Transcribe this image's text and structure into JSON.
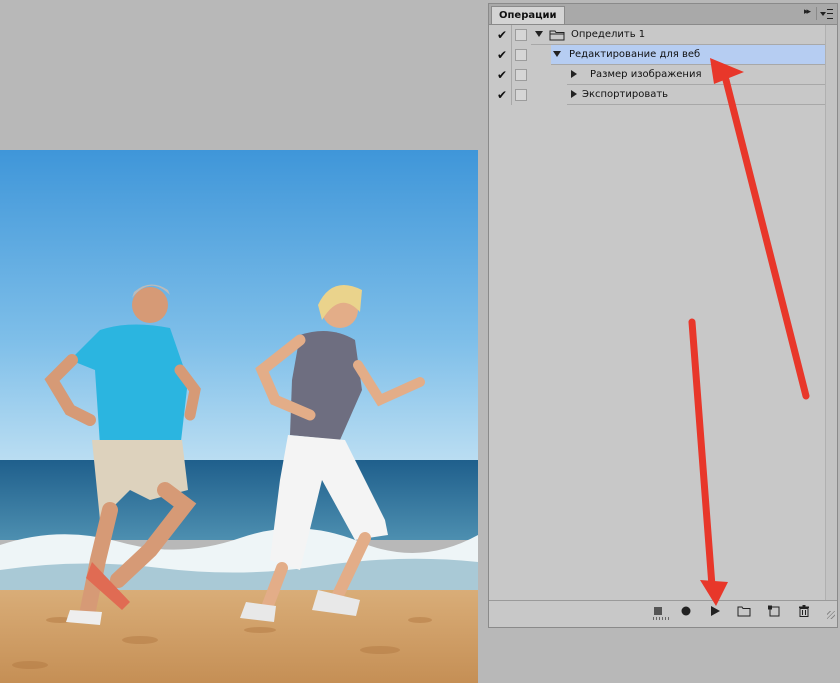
{
  "panel": {
    "tab_label": "Операции",
    "collapse_glyph": "▸▸",
    "actions": [
      {
        "label": "Определить 1",
        "checked": true,
        "expanded": true,
        "kind": "set",
        "selected": false
      },
      {
        "label": "Редактирование для веб",
        "checked": true,
        "expanded": true,
        "kind": "action",
        "selected": true
      },
      {
        "label": "Размер изображения",
        "checked": true,
        "expanded": false,
        "kind": "step",
        "selected": false
      },
      {
        "label": "Экспортировать",
        "checked": true,
        "expanded": false,
        "kind": "step",
        "selected": false
      }
    ],
    "footer_tools": [
      "stop-icon",
      "record-icon",
      "play-icon",
      "new-set-folder-icon",
      "new-action-icon",
      "trash-icon"
    ]
  },
  "icons": {
    "check": "✔"
  },
  "colors": {
    "selection": "#b6cdf2",
    "annotation_arrow": "#e8372a",
    "workspace": "#b8b8b8"
  }
}
